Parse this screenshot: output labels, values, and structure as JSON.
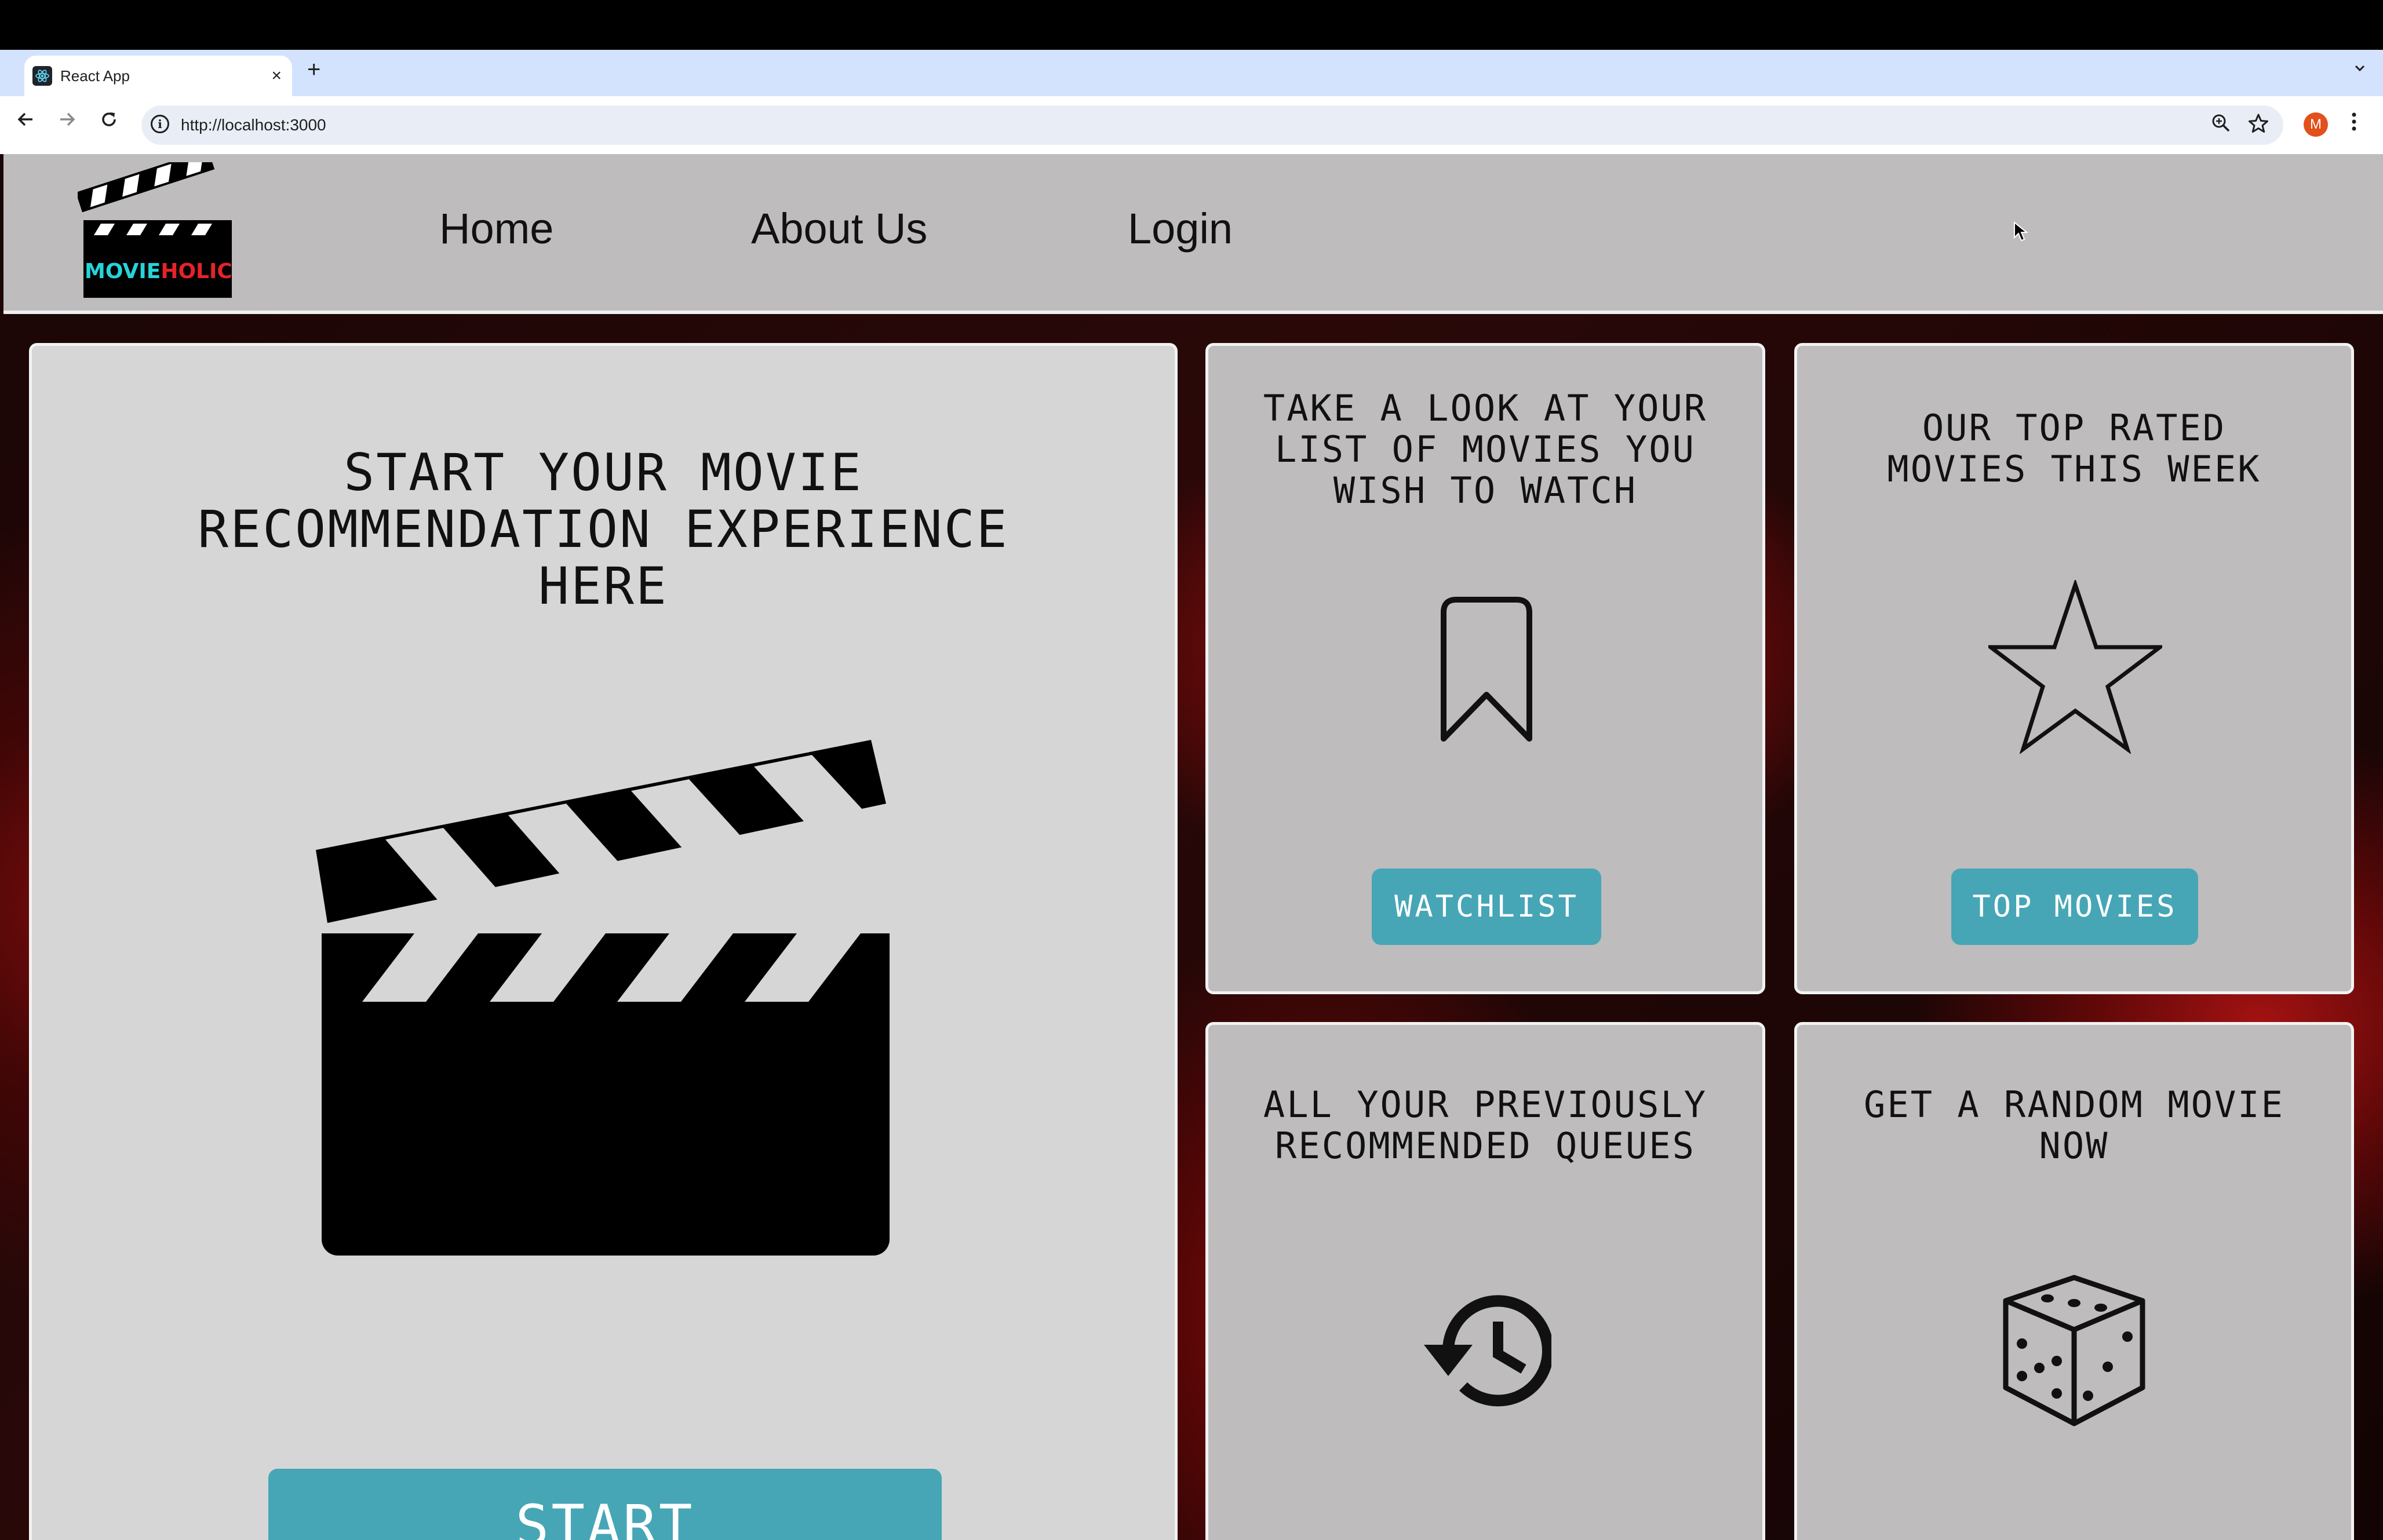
{
  "browser": {
    "tab_title": "React App",
    "new_tab": "+",
    "close": "×",
    "url": "http://localhost:3000",
    "profile_initial": "M"
  },
  "header": {
    "logo_text_part1": "MOVIE",
    "logo_text_part2": "HOLIC",
    "nav": [
      "Home",
      "About Us",
      "Login"
    ]
  },
  "main_card": {
    "title": "START YOUR MOVIE\nRECOMMENDATION EXPERIENCE\nHERE",
    "button": "START"
  },
  "cards": [
    {
      "title": "TAKE A LOOK AT YOUR\nLIST OF MOVIES YOU\nWISH TO WATCH",
      "icon": "bookmark-icon",
      "button": "WATCHLIST"
    },
    {
      "title": "OUR TOP RATED\nMOVIES THIS WEEK",
      "icon": "star-icon",
      "button": "TOP MOVIES"
    },
    {
      "title": "ALL YOUR PREVIOUSLY\nRECOMMENDED QUEUES",
      "icon": "history-icon"
    },
    {
      "title": "GET A RANDOM MOVIE\nNOW",
      "icon": "dice-icon"
    }
  ],
  "colors": {
    "header_bg": "#bebcbd",
    "card_bg": "#bebcbd",
    "main_card_bg": "#d6d6d6",
    "button_bg": "#46a6b6",
    "logo_cyan": "#27d3d8",
    "logo_red": "#e5232a"
  }
}
